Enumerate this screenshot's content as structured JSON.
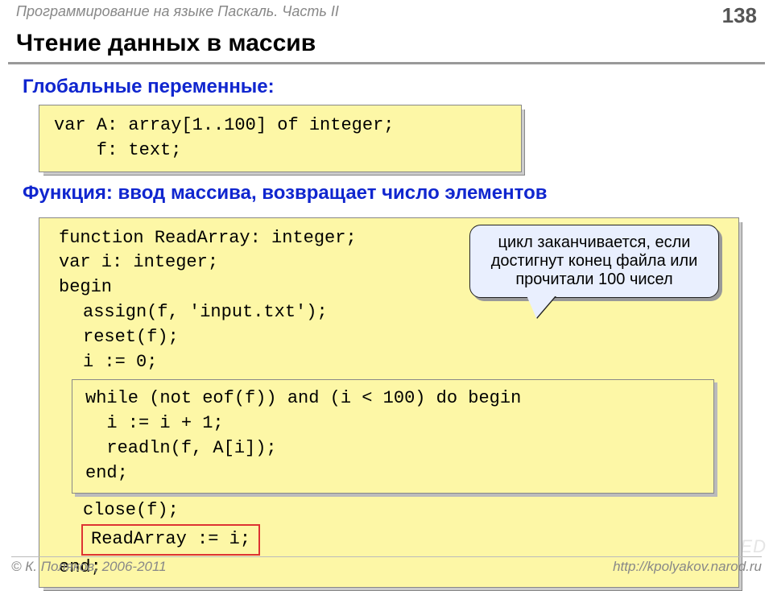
{
  "header": {
    "breadcrumb": "Программирование на языке Паскаль. Часть II",
    "page_number": "138"
  },
  "title": "Чтение данных в массив",
  "section_globals": "Глобальные переменные:",
  "code_globals_l1": "var A: array[1..100] of integer;",
  "code_globals_l2": "    f: text;",
  "section_func": "Функция: ввод массива, возвращает число элементов",
  "code_fn": {
    "l1": "function ReadArray: integer;",
    "l2": "var i: integer;",
    "l3": "begin",
    "l4": "assign(f, 'input.txt');",
    "l5": "reset(f);",
    "l6": "i := 0;",
    "while_l1": "while (not eof(f)) and (i < 100) do begin",
    "while_l2": "  i := i + 1;",
    "while_l3": "  readln(f, A[i]);",
    "while_l4": "end;",
    "l7": "close(f);",
    "ret": "ReadArray := i;",
    "l8": "end;"
  },
  "callout": "цикл заканчивается, если достигнут конец файла или прочитали 100 чисел",
  "footer": {
    "left": "© К. Поляков, 2006-2011",
    "right": "http://kpolyakov.narod.ru"
  },
  "watermark": "MYSHARED"
}
